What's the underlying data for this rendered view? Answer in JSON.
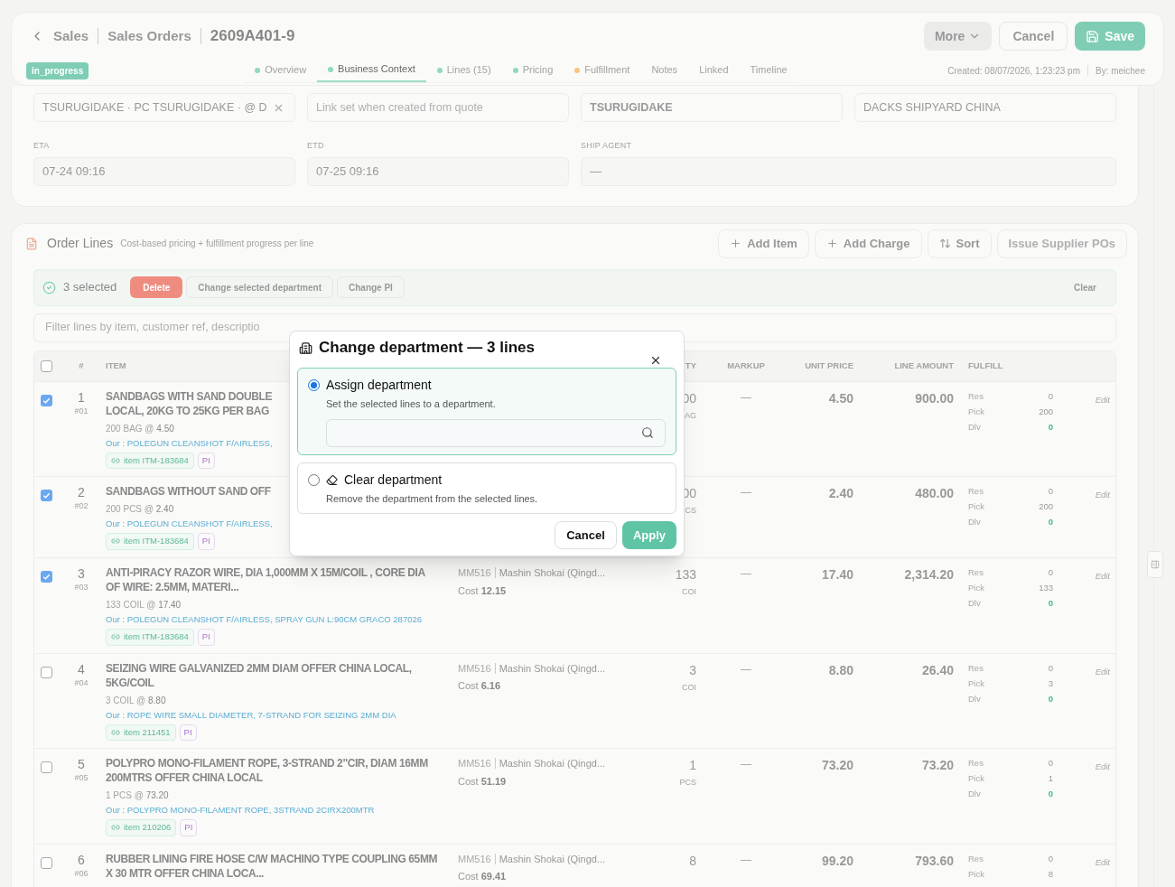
{
  "header": {
    "breadcrumbs": [
      "Sales",
      "Sales Orders"
    ],
    "title": "2609A401-9",
    "status": "in_progress",
    "more": "More",
    "cancel": "Cancel",
    "save": "Save",
    "tabs": [
      {
        "label": "Overview",
        "color": "#8fd9bf",
        "selected": false
      },
      {
        "label": "Business Context",
        "color": "#8fd9bf",
        "selected": true
      },
      {
        "label": "Lines (15)",
        "color": "#8fd9bf",
        "selected": false
      },
      {
        "label": "Pricing",
        "color": "#8fd9bf",
        "selected": false
      },
      {
        "label": "Fulfillment",
        "color": "#f5c77e",
        "selected": false
      },
      {
        "label": "Notes",
        "selected": false
      },
      {
        "label": "Linked",
        "selected": false
      },
      {
        "label": "Timeline",
        "selected": false
      }
    ],
    "created": "Created: 08/07/2026, 1:23:23 pm",
    "by": "By: meichee"
  },
  "context": {
    "top_fields": [
      {
        "kind": "chip",
        "value": "TSURUGIDAKE · PC TSURUGIDAKE · @ D"
      },
      {
        "kind": "empty",
        "placeholder": "Link set when created from quote"
      },
      {
        "kind": "strong",
        "value": "TSURUGIDAKE"
      },
      {
        "kind": "plain",
        "value": "DACKS SHIPYARD CHINA"
      }
    ],
    "fields": [
      {
        "label": "ETA",
        "value": "07-24 09:16",
        "wide": false
      },
      {
        "label": "ETD",
        "value": "07-25 09:16",
        "wide": false
      },
      {
        "label": "SHIP AGENT",
        "value": "—",
        "wide": true
      }
    ]
  },
  "order_lines": {
    "title": "Order Lines",
    "subtitle": "Cost-based pricing + fulfillment progress per line",
    "actions": [
      {
        "kind": "add",
        "label": "Add Item"
      },
      {
        "kind": "add",
        "label": "Add Charge"
      },
      {
        "kind": "sort",
        "label": "Sort"
      },
      {
        "kind": "disabled",
        "label": "Issue Supplier POs"
      }
    ],
    "selection": {
      "count": "3 selected",
      "delete": "Delete",
      "buttons": [
        "Change selected department",
        "Change PI"
      ],
      "clear": "Clear"
    },
    "filter_placeholder": "Filter lines by item, customer ref, descriptio",
    "all_selected": false,
    "columns": {
      "num": "#",
      "item": "ITEM",
      "qty": "TY",
      "markup": "MARKUP",
      "unit_price": "UNIT PRICE",
      "amount": "LINE AMOUNT",
      "fulfill": "FULFILL"
    },
    "rows": [
      {
        "selected": true,
        "num": "1",
        "code": "#01",
        "name": "SANDBAGS WITH SAND DOUBLE LOCAL, 20KG TO 25KG PER BAG",
        "qty_text": "200 BAG @",
        "price": "4.50",
        "our": "Our : POLEGUN CLEANSHOT F/AIRLESS,",
        "tag": "item ITM-183684",
        "pi": "PI",
        "qty": "00",
        "unit": "AG",
        "markup": "—",
        "unit_price": "4.50",
        "amount": "900.00",
        "fulfill": [
          {
            "label": "Res",
            "value": "0",
            "kind": "count"
          },
          {
            "label": "Pick",
            "value": "200",
            "kind": "count"
          },
          {
            "label": "Dlv",
            "value": "0",
            "kind": "delivered"
          }
        ],
        "edit": "Edit"
      },
      {
        "selected": true,
        "num": "2",
        "code": "#02",
        "name": "SANDBAGS WITHOUT SAND OFF",
        "qty_text": "200 PCS @",
        "price": "2.40",
        "our": "Our : POLEGUN CLEANSHOT F/AIRLESS,",
        "tag": "item ITM-183684",
        "pi": "PI",
        "qty": "00",
        "unit": "CS",
        "markup": "—",
        "unit_price": "2.40",
        "amount": "480.00",
        "fulfill": [
          {
            "label": "Res",
            "value": "0",
            "kind": "count"
          },
          {
            "label": "Pick",
            "value": "200",
            "kind": "count"
          },
          {
            "label": "Dlv",
            "value": "0",
            "kind": "delivered"
          }
        ],
        "edit": "Edit"
      },
      {
        "selected": true,
        "num": "3",
        "code": "#03",
        "name": "ANTI-PIRACY RAZOR WIRE, DIA 1,000MM X 15M/COIL , CORE DIA OF WIRE: 2.5MM, MATERI...",
        "qty_text": "133 COIL @",
        "price": "17.40",
        "our": "Our : POLEGUN CLEANSHOT F/AIRLESS, SPRAY GUN L:90CM GRACO 287026",
        "tag": "item ITM-183684",
        "pi": "PI",
        "supplier_code": "MM516",
        "supplier": "Mashin Shokai (Qingd...",
        "cost_label": "Cost",
        "cost": "12.15",
        "qty": "133",
        "unit": "COI",
        "markup": "—",
        "unit_price": "17.40",
        "amount": "2,314.20",
        "fulfill": [
          {
            "label": "Res",
            "value": "0",
            "kind": "count"
          },
          {
            "label": "Pick",
            "value": "133",
            "kind": "count"
          },
          {
            "label": "Dlv",
            "value": "0",
            "kind": "delivered"
          }
        ],
        "edit": "Edit"
      },
      {
        "selected": false,
        "num": "4",
        "code": "#04",
        "name": "SEIZING WIRE GALVANIZED 2MM DIAM OFFER CHINA LOCAL, 5KG/COIL",
        "qty_text": "3 COIL @",
        "price": "8.80",
        "our": "Our : ROPE WIRE SMALL DIAMETER, 7-STRAND FOR SEIZING 2MM DIA",
        "tag": "item 211451",
        "pi": "PI",
        "supplier_code": "MM516",
        "supplier": "Mashin Shokai (Qingd...",
        "cost_label": "Cost",
        "cost": "6.16",
        "qty": "3",
        "unit": "COI",
        "markup": "—",
        "unit_price": "8.80",
        "amount": "26.40",
        "fulfill": [
          {
            "label": "Res",
            "value": "0",
            "kind": "count"
          },
          {
            "label": "Pick",
            "value": "3",
            "kind": "count"
          },
          {
            "label": "Dlv",
            "value": "0",
            "kind": "delivered"
          }
        ],
        "edit": "Edit"
      },
      {
        "selected": false,
        "num": "5",
        "code": "#05",
        "name": "POLYPRO MONO-FILAMENT ROPE, 3-STRAND 2\"CIR, DIAM 16MM 200MTRS OFFER CHINA LOCAL",
        "qty_text": "1 PCS @",
        "price": "73.20",
        "our": "Our : POLYPRO MONO-FILAMENT ROPE, 3STRAND 2CIRX200MTR",
        "tag": "item 210206",
        "pi": "PI",
        "supplier_code": "MM516",
        "supplier": "Mashin Shokai (Qingd...",
        "cost_label": "Cost",
        "cost": "51.19",
        "qty": "1",
        "unit": "PCS",
        "markup": "—",
        "unit_price": "73.20",
        "amount": "73.20",
        "fulfill": [
          {
            "label": "Res",
            "value": "0",
            "kind": "count"
          },
          {
            "label": "Pick",
            "value": "1",
            "kind": "count"
          },
          {
            "label": "Dlv",
            "value": "0",
            "kind": "delivered"
          }
        ],
        "edit": "Edit"
      },
      {
        "selected": false,
        "num": "6",
        "code": "#06",
        "name": "RUBBER LINING FIRE HOSE C/W MACHINO TYPE COUPLING 65MM X 30 MTR OFFER CHINA LOCA...",
        "supplier_code": "MM516",
        "supplier": "Mashin Shokai (Qingd...",
        "cost_label": "Cost",
        "cost": "69.41",
        "qty": "8",
        "markup": "—",
        "unit_price": "99.20",
        "amount": "793.60",
        "fulfill": [
          {
            "label": "Res",
            "value": "0",
            "kind": "count"
          },
          {
            "label": "Pick",
            "value": "8",
            "kind": "count"
          }
        ],
        "edit": "Edit"
      }
    ]
  },
  "dialog": {
    "title": "Change department — 3 lines",
    "options": [
      {
        "kind": "assign",
        "selected": true,
        "title": "Assign department",
        "text": "Set the selected lines to a department."
      },
      {
        "kind": "clear",
        "selected": false,
        "title": "Clear department",
        "text": "Remove the department from the selected lines."
      }
    ],
    "cancel": "Cancel",
    "apply": "Apply"
  }
}
